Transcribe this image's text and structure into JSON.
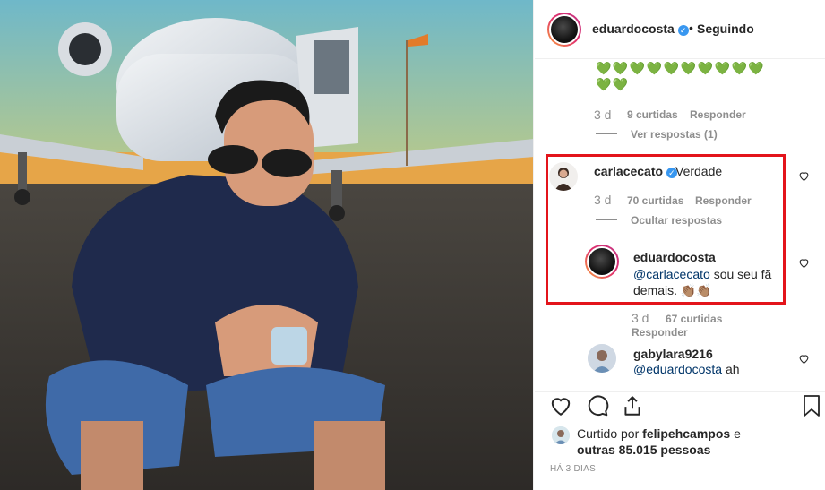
{
  "header": {
    "username": "eduardocosta",
    "separator": "•",
    "follow_status": "Seguindo"
  },
  "comments": {
    "hearts_row1": "💚💚💚💚💚💚💚💚💚💚",
    "hearts_row2": "💚💚",
    "first_time": "3 d",
    "first_likes": "9 curtidas",
    "first_reply": "Responder",
    "first_view_replies": "Ver respostas (1)",
    "carla": {
      "username": "carlacecato",
      "text": "Verdade",
      "time": "3 d",
      "likes": "70 curtidas",
      "reply": "Responder",
      "hide_replies": "Ocultar respostas"
    },
    "reply": {
      "username": "eduardocosta",
      "mention": "@carlacecato",
      "text_line1": " sou seu fã",
      "text_line2": "demais. 👏🏽👏🏽",
      "time": "3 d",
      "likes": "67 curtidas",
      "reply": "Responder"
    },
    "gaby": {
      "username": "gabylara9216",
      "mention": "@eduardocosta",
      "text": " ah"
    }
  },
  "liked_by": {
    "prefix": "Curtido por ",
    "user": "felipehcampos",
    "mid": " e",
    "others": "outras 85.015 pessoas"
  },
  "post_date": "HÁ 3 DIAS",
  "icons": {
    "like": "heart-icon",
    "comment": "comment-icon",
    "share": "share-icon",
    "save": "bookmark-icon"
  },
  "colors": {
    "verified": "#3897f0",
    "highlight_box": "#e3141b",
    "mention": "#003569",
    "secondary_text": "#8e8e8e"
  }
}
